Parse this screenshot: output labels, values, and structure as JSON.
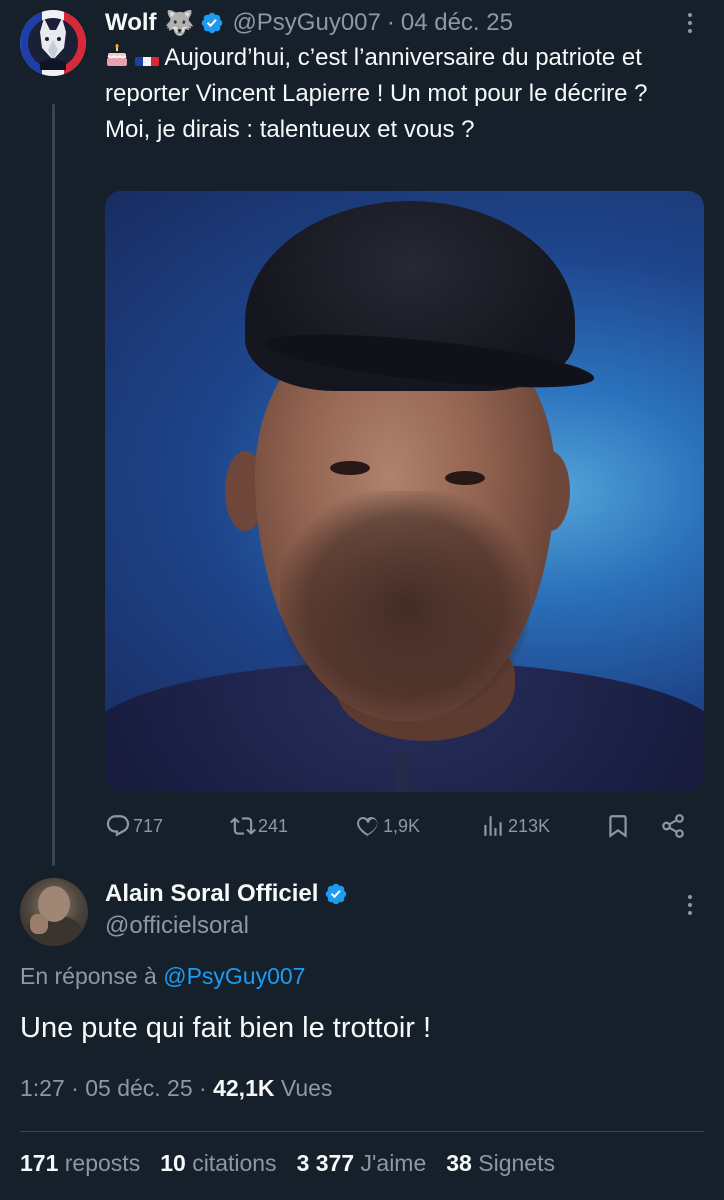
{
  "tweet": {
    "author_name": "Wolf",
    "author_emoji": "🐺",
    "handle": "@PsyGuy007",
    "separator": "·",
    "date": "04 déc. 25",
    "text": "Aujourd’hui, c’est l’anniversaire du patriote et reporter Vincent Lapierre ! Un mot pour le décrire ? Moi, je dirais : talentueux et vous ?",
    "actions": {
      "replies": "717",
      "reposts": "241",
      "likes": "1,9K",
      "views": "213K"
    }
  },
  "reply": {
    "author_name": "Alain Soral Officiel",
    "handle": "@officielsoral",
    "reply_prefix": "En réponse à",
    "reply_handle": "@PsyGuy007",
    "text": "Une pute qui fait bien le trottoir !",
    "time": "1:27",
    "sep1": "·",
    "date": "05 déc. 25",
    "sep2": "·",
    "views_count": "42,1K",
    "views_label": "Vues",
    "stats": {
      "reposts_count": "171",
      "reposts_label": "reposts",
      "citations_count": "10",
      "citations_label": "citations",
      "likes_count": "3 377",
      "likes_label": "J'aime",
      "bookmarks_count": "38",
      "bookmarks_label": "Signets"
    }
  },
  "colors": {
    "background": "#15202b",
    "text": "#f7f9f9",
    "muted": "#8b98a5",
    "accent": "#1d9bf0"
  }
}
